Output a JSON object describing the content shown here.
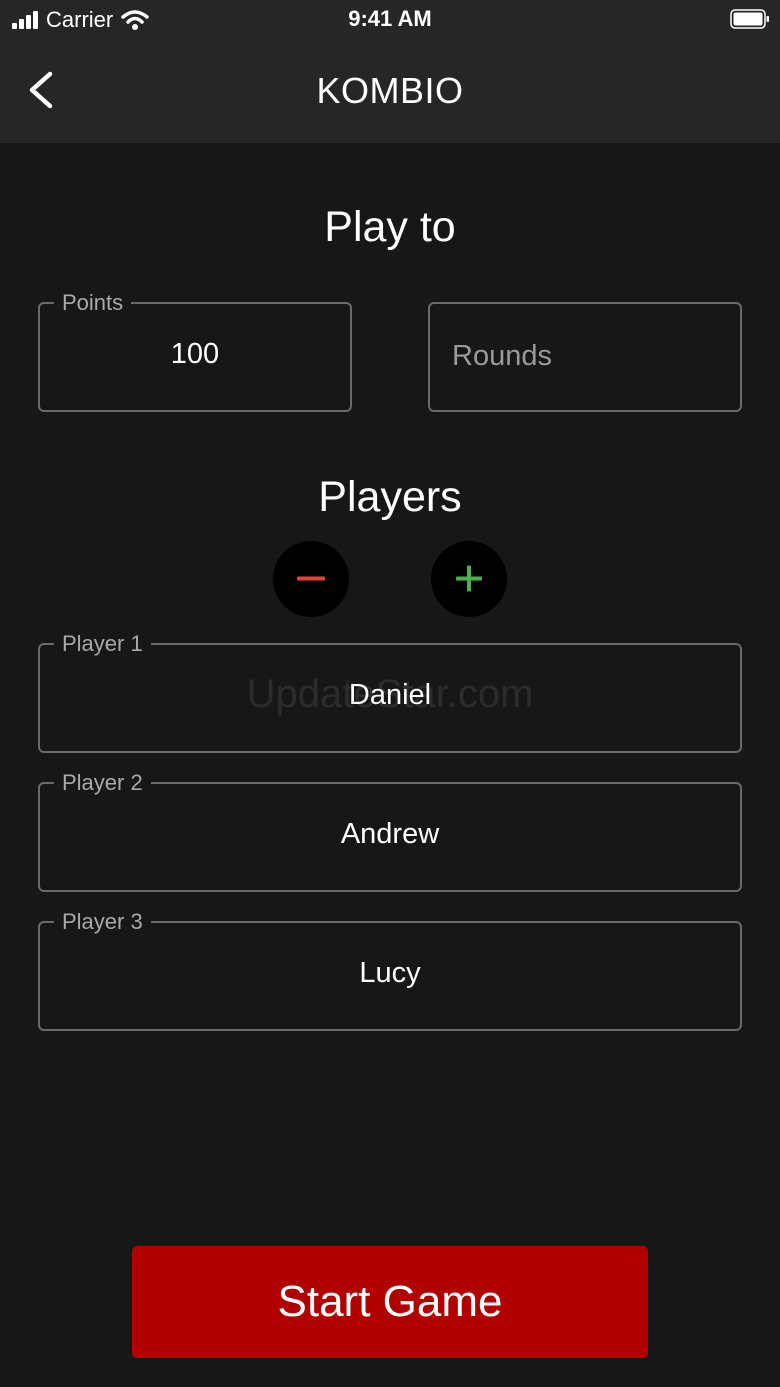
{
  "status_bar": {
    "carrier": "Carrier",
    "time": "9:41 AM"
  },
  "nav": {
    "title": "KOMBIO",
    "back_icon": "chevron-left-icon"
  },
  "play_to": {
    "heading": "Play to",
    "points": {
      "label": "Points",
      "value": "100"
    },
    "rounds": {
      "placeholder": "Rounds"
    }
  },
  "players": {
    "heading": "Players",
    "remove_icon": "minus-icon",
    "add_icon": "plus-icon",
    "list": [
      {
        "label": "Player 1",
        "value": "Daniel"
      },
      {
        "label": "Player 2",
        "value": "Andrew"
      },
      {
        "label": "Player 3",
        "value": "Lucy"
      }
    ]
  },
  "watermark": "UpdateStar.com",
  "start_button": {
    "label": "Start Game"
  },
  "colors": {
    "background": "#171717",
    "bar": "#262626",
    "minus": "#e0443a",
    "plus": "#4caf50",
    "start": "#b00000"
  }
}
